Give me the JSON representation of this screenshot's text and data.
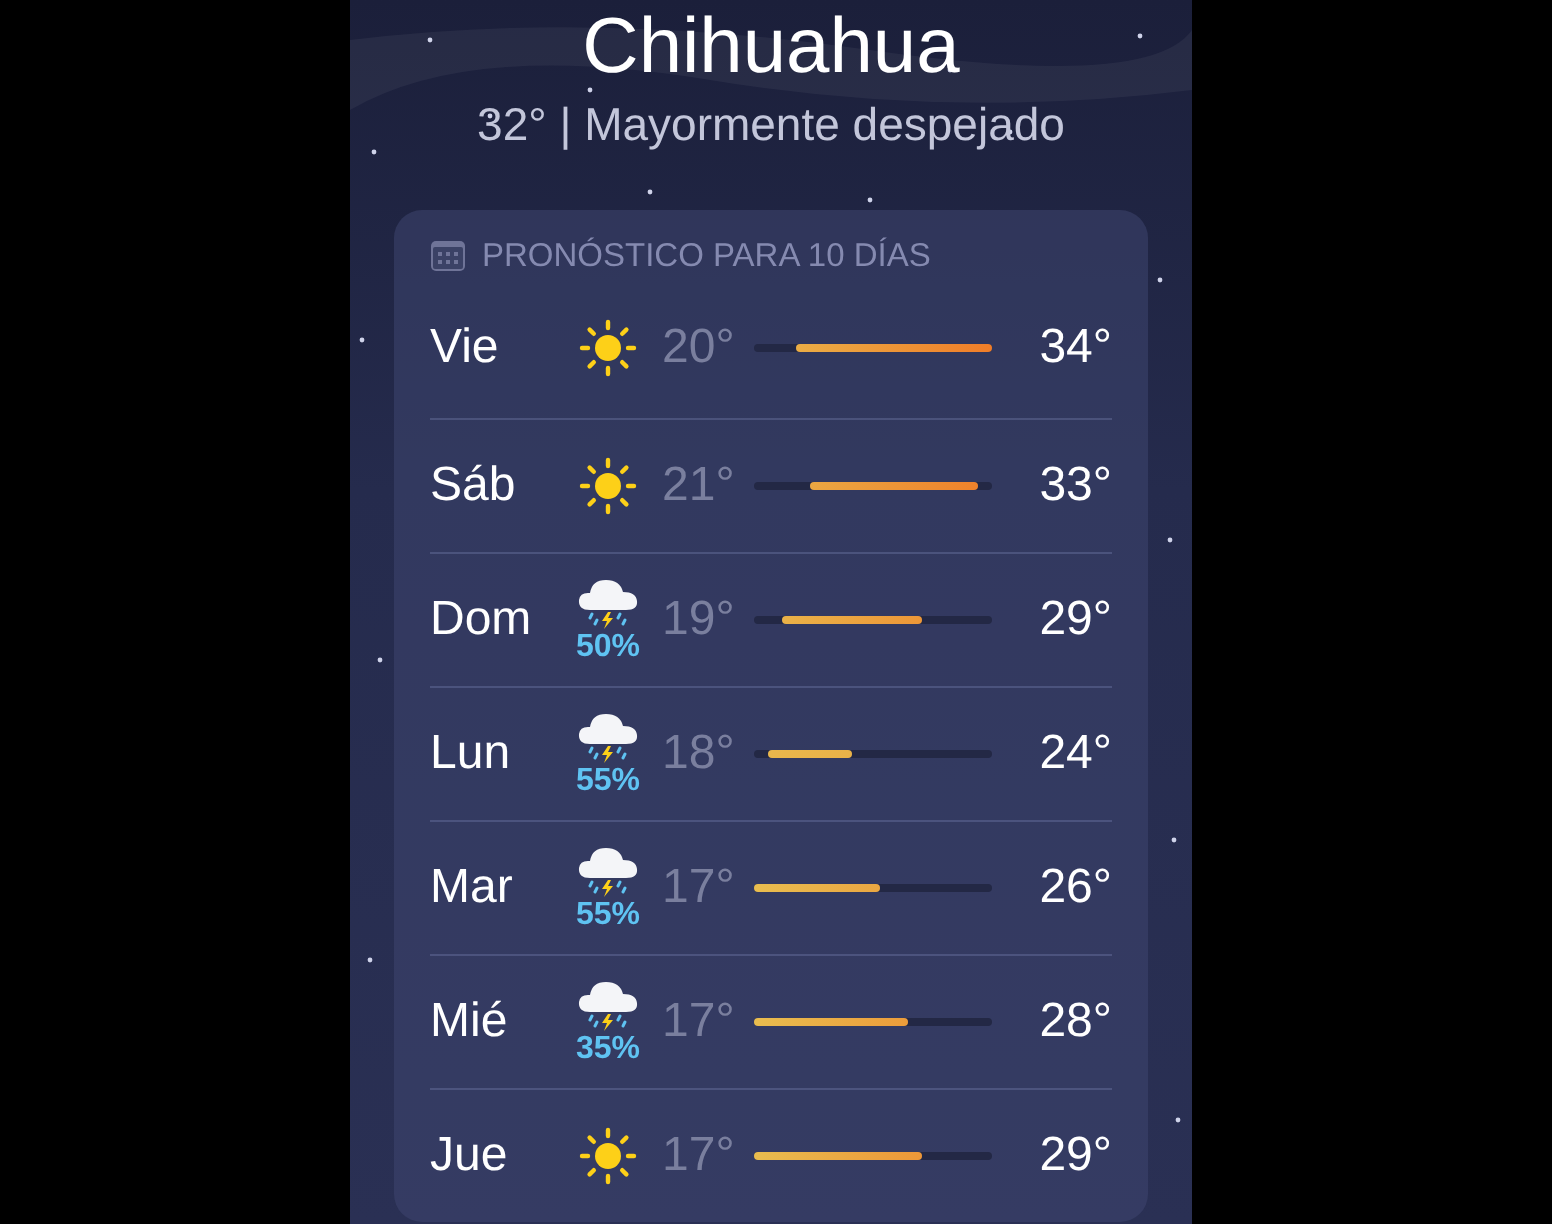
{
  "location": {
    "city": "Chihuahua",
    "summary": "32° | Mayormente despejado"
  },
  "forecast": {
    "title": "PRONÓSTICO PARA 10 DÍAS",
    "days": [
      {
        "day": "Vie",
        "kind": "sun",
        "low": "20°",
        "high": "34°"
      },
      {
        "day": "Sáb",
        "kind": "sun",
        "low": "21°",
        "high": "33°"
      },
      {
        "day": "Dom",
        "kind": "storm",
        "chance": "50%",
        "low": "19°",
        "high": "29°"
      },
      {
        "day": "Lun",
        "kind": "storm",
        "chance": "55%",
        "low": "18°",
        "high": "24°"
      },
      {
        "day": "Mar",
        "kind": "storm",
        "chance": "55%",
        "low": "17°",
        "high": "26°"
      },
      {
        "day": "Mié",
        "kind": "storm",
        "chance": "35%",
        "low": "17°",
        "high": "28°"
      },
      {
        "day": "Jue",
        "kind": "sun",
        "low": "17°",
        "high": "29°"
      }
    ]
  }
}
